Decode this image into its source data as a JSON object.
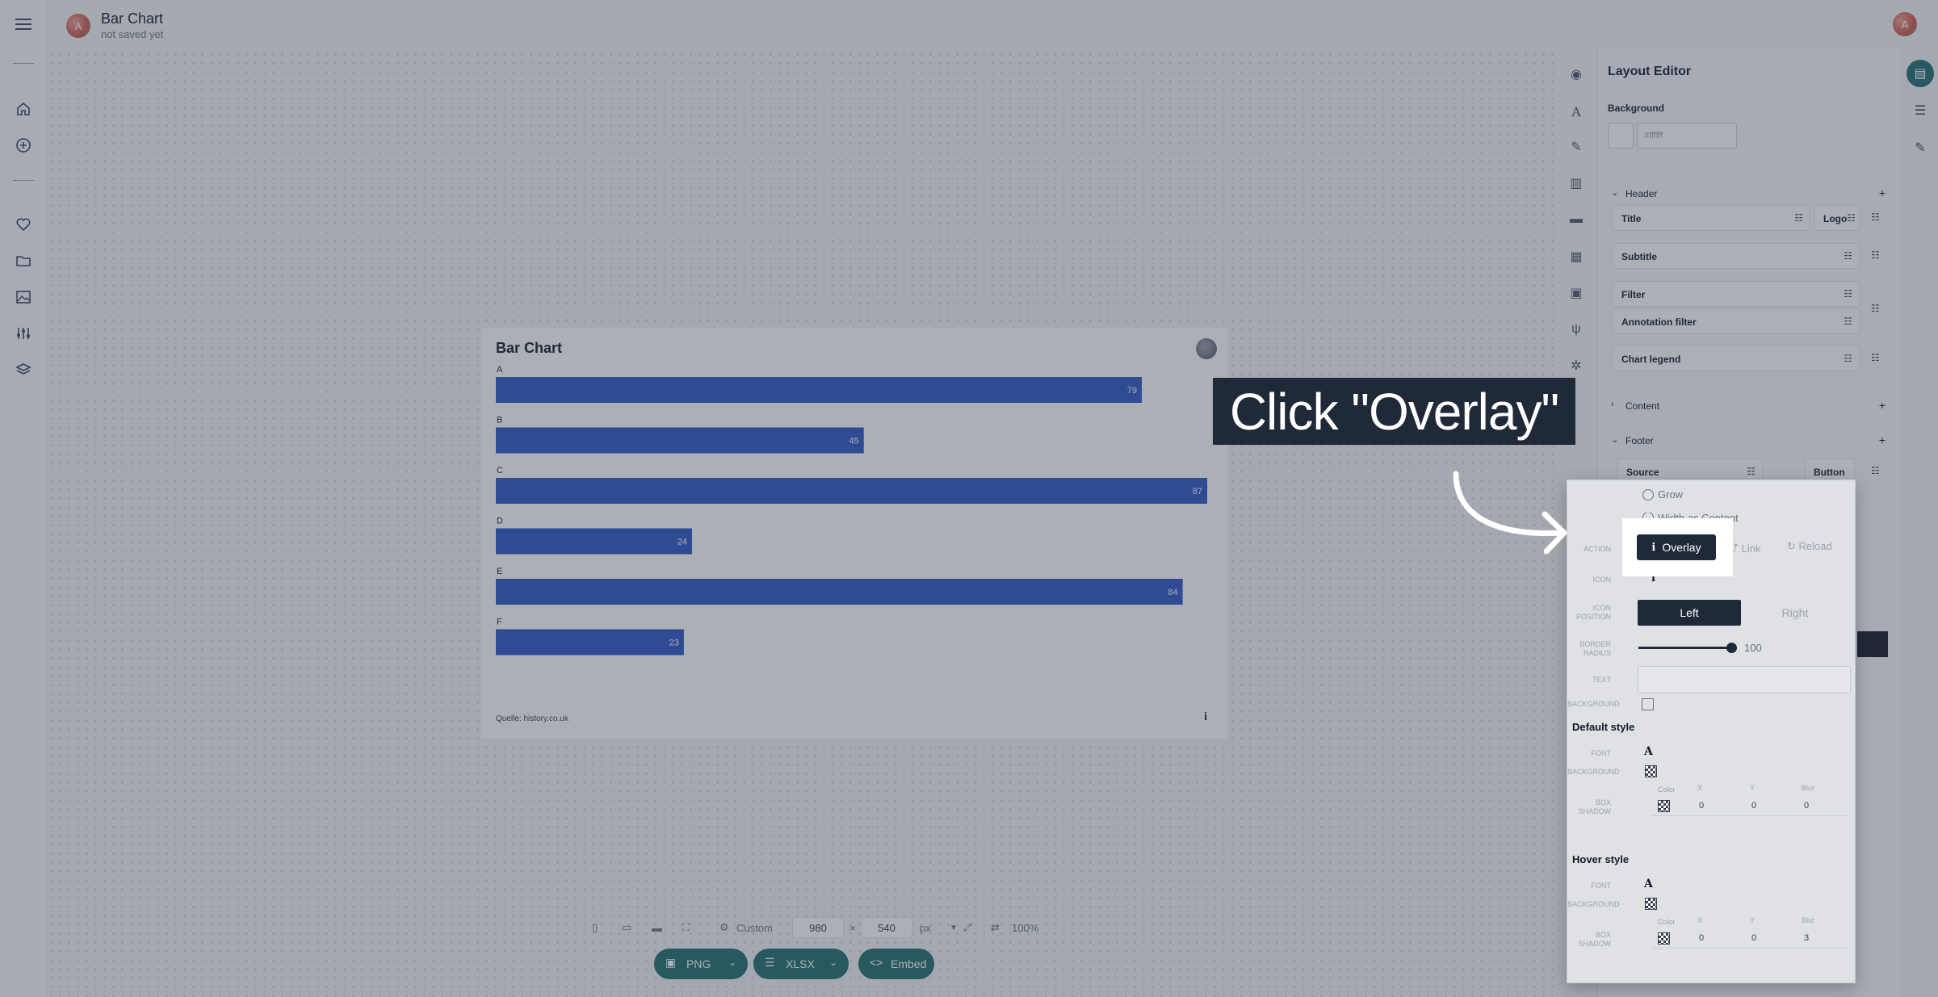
{
  "app": {
    "doc_title": "Bar Chart",
    "doc_status": "not saved yet",
    "avatar_letter": "A"
  },
  "left_nav": [
    "menu-icon",
    "home-icon",
    "plus-circle-icon",
    "heart-icon",
    "folder-icon",
    "image-icon",
    "sliders-icon",
    "layers-icon"
  ],
  "chart_data": {
    "type": "bar",
    "orientation": "horizontal",
    "title": "Bar Chart",
    "categories": [
      "A",
      "B",
      "C",
      "D",
      "E",
      "F"
    ],
    "values": [
      79,
      45,
      87,
      24,
      84,
      23
    ],
    "xlim": [
      0,
      87
    ],
    "bar_color": "#2854c5",
    "source": "Quelle: history.co.uk",
    "info_icon": "i"
  },
  "size_bar": {
    "preset": "Custom",
    "width": "980",
    "times": "×",
    "height": "540",
    "unit": "px",
    "zoom": "100%"
  },
  "export": {
    "png": "PNG",
    "xlsx": "XLSX",
    "embed": "Embed"
  },
  "layout_editor": {
    "title": "Layout Editor",
    "background_label": "Background",
    "background_hex_placeholder": "#ffffff",
    "sections": {
      "header": "Header",
      "content": "Content",
      "footer": "Footer"
    },
    "rows": {
      "title": "Title",
      "logo": "Logo",
      "subtitle": "Subtitle",
      "filter": "Filter",
      "annotation_filter": "Annotation filter",
      "chart_legend": "Chart legend",
      "source": "Source",
      "button": "Button"
    }
  },
  "popover": {
    "radio_grow": "Grow",
    "radio_other": "Width as Content",
    "action_label": "ACTION",
    "actions": {
      "overlay": "Overlay",
      "link": "Link",
      "reload": "Reload"
    },
    "icon_label": "ICON",
    "icon_glyph": "i",
    "icon_position_label": "ICON POSITION",
    "pos_left": "Left",
    "pos_right": "Right",
    "border_radius_label": "BORDER RADIUS",
    "border_radius_value": "100",
    "text_label": "TEXT",
    "background_label": "BACKGROUND",
    "default_style": "Default style",
    "hover_style": "Hover style",
    "font_label": "FONT",
    "bg_label": "BACKGROUND",
    "box_shadow_label": "BOX SHADOW",
    "shadow_cols": [
      "Color",
      "X",
      "Y",
      "Blur"
    ],
    "default_shadow": [
      "0",
      "0",
      "0"
    ],
    "hover_shadow": [
      "0",
      "0",
      "3"
    ],
    "font_glyph": "A"
  },
  "callout": {
    "text": "Click \"Overlay\""
  }
}
